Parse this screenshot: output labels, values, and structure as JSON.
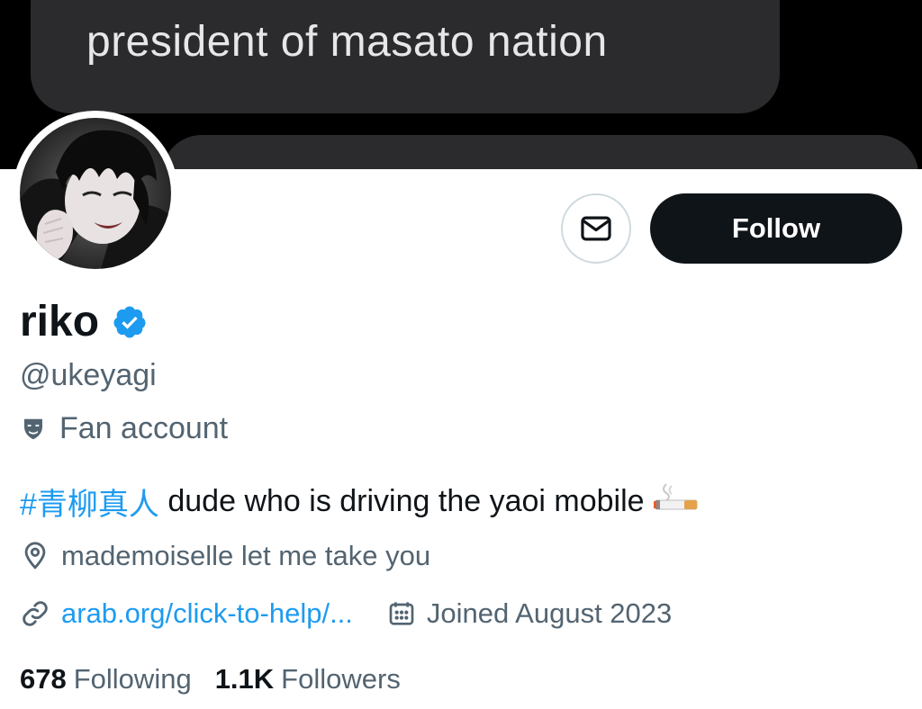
{
  "banner": {
    "message_text": "president of masato nation"
  },
  "actions": {
    "message_icon": "envelope-icon",
    "follow_label": "Follow"
  },
  "profile": {
    "display_name": "riko",
    "verified_icon": "verified-badge-icon",
    "handle": "@ukeyagi",
    "category_icon": "theater-mask-icon",
    "category": "Fan account",
    "bio_hashtag": "#青柳真人",
    "bio_text": " dude who is driving the yaoi mobile",
    "bio_emoji": "cigarette-emoji",
    "location_icon": "location-pin-icon",
    "location": "mademoiselle let me take you",
    "link_icon": "link-icon",
    "link": "arab.org/click-to-help/...",
    "calendar_icon": "calendar-icon",
    "joined": "Joined August 2023"
  },
  "stats": {
    "following_count": "678",
    "following_label": "Following",
    "followers_count": "1.1K",
    "followers_label": "Followers"
  },
  "colors": {
    "accent": "#1d9bf0",
    "text_primary": "#0f1419",
    "text_secondary": "#536471",
    "button_dark": "#0f1419"
  }
}
